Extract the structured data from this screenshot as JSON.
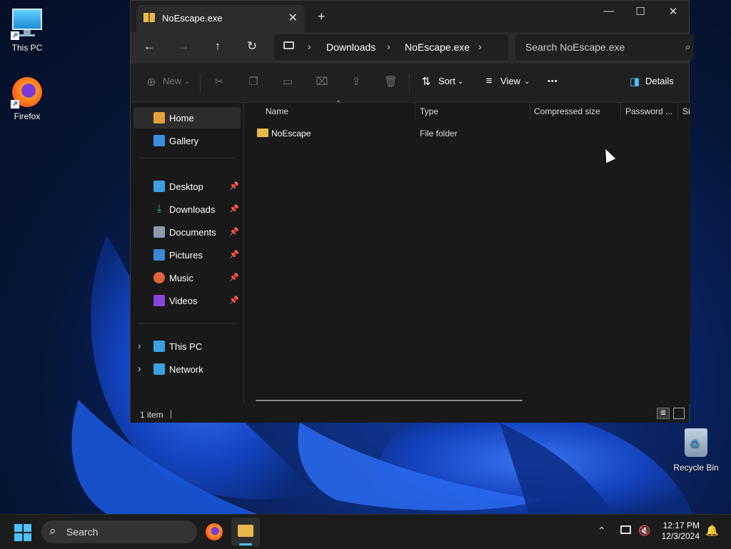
{
  "desktop": {
    "icons": [
      {
        "label": "This PC"
      },
      {
        "label": "Firefox"
      },
      {
        "label": "Recycle Bin"
      }
    ]
  },
  "window": {
    "tab_title": "NoEscape.exe",
    "tab_close_glyph": "✕",
    "new_tab_glyph": "+",
    "controls": {
      "minimize": "—",
      "maximize": "☐",
      "close": "✕"
    }
  },
  "address": {
    "back_glyph": "←",
    "forward_glyph": "→",
    "up_glyph": "↑",
    "refresh_glyph": "↻",
    "breadcrumbs": [
      "Downloads",
      "NoEscape.exe"
    ],
    "search_placeholder": "Search NoEscape.exe"
  },
  "toolbar": {
    "new_label": "New",
    "sort_label": "Sort",
    "view_label": "View",
    "more_glyph": "•••",
    "details_label": "Details"
  },
  "sidebar": {
    "items": [
      {
        "label": "Home",
        "icon": "home-icon",
        "color": "#e2a23b"
      },
      {
        "label": "Gallery",
        "icon": "gallery-icon",
        "color": "#3b8ee0"
      },
      {
        "label": "Desktop",
        "icon": "desktop-icon",
        "color": "#3aa0e0"
      },
      {
        "label": "Downloads",
        "icon": "download-icon",
        "color": "#3cc17a"
      },
      {
        "label": "Documents",
        "icon": "documents-icon",
        "color": "#8a9bb0"
      },
      {
        "label": "Pictures",
        "icon": "pictures-icon",
        "color": "#3b86d6"
      },
      {
        "label": "Music",
        "icon": "music-icon",
        "color": "#e0643b"
      },
      {
        "label": "Videos",
        "icon": "videos-icon",
        "color": "#8a45d8"
      },
      {
        "label": "This PC",
        "icon": "this-pc-icon",
        "color": "#3aa0e0"
      },
      {
        "label": "Network",
        "icon": "network-icon",
        "color": "#3aa0e0"
      }
    ]
  },
  "files": {
    "columns": [
      "Name",
      "Type",
      "Compressed size",
      "Password ...",
      "Si"
    ],
    "rows": [
      {
        "name": "NoEscape",
        "type": "File folder"
      }
    ]
  },
  "status": {
    "count": "1 item"
  },
  "taskbar": {
    "search_label": "Search",
    "time": "12:17 PM",
    "date": "12/3/2024"
  },
  "colors": {
    "accent": "#4cc2ff",
    "folder": "#e8b84a"
  }
}
